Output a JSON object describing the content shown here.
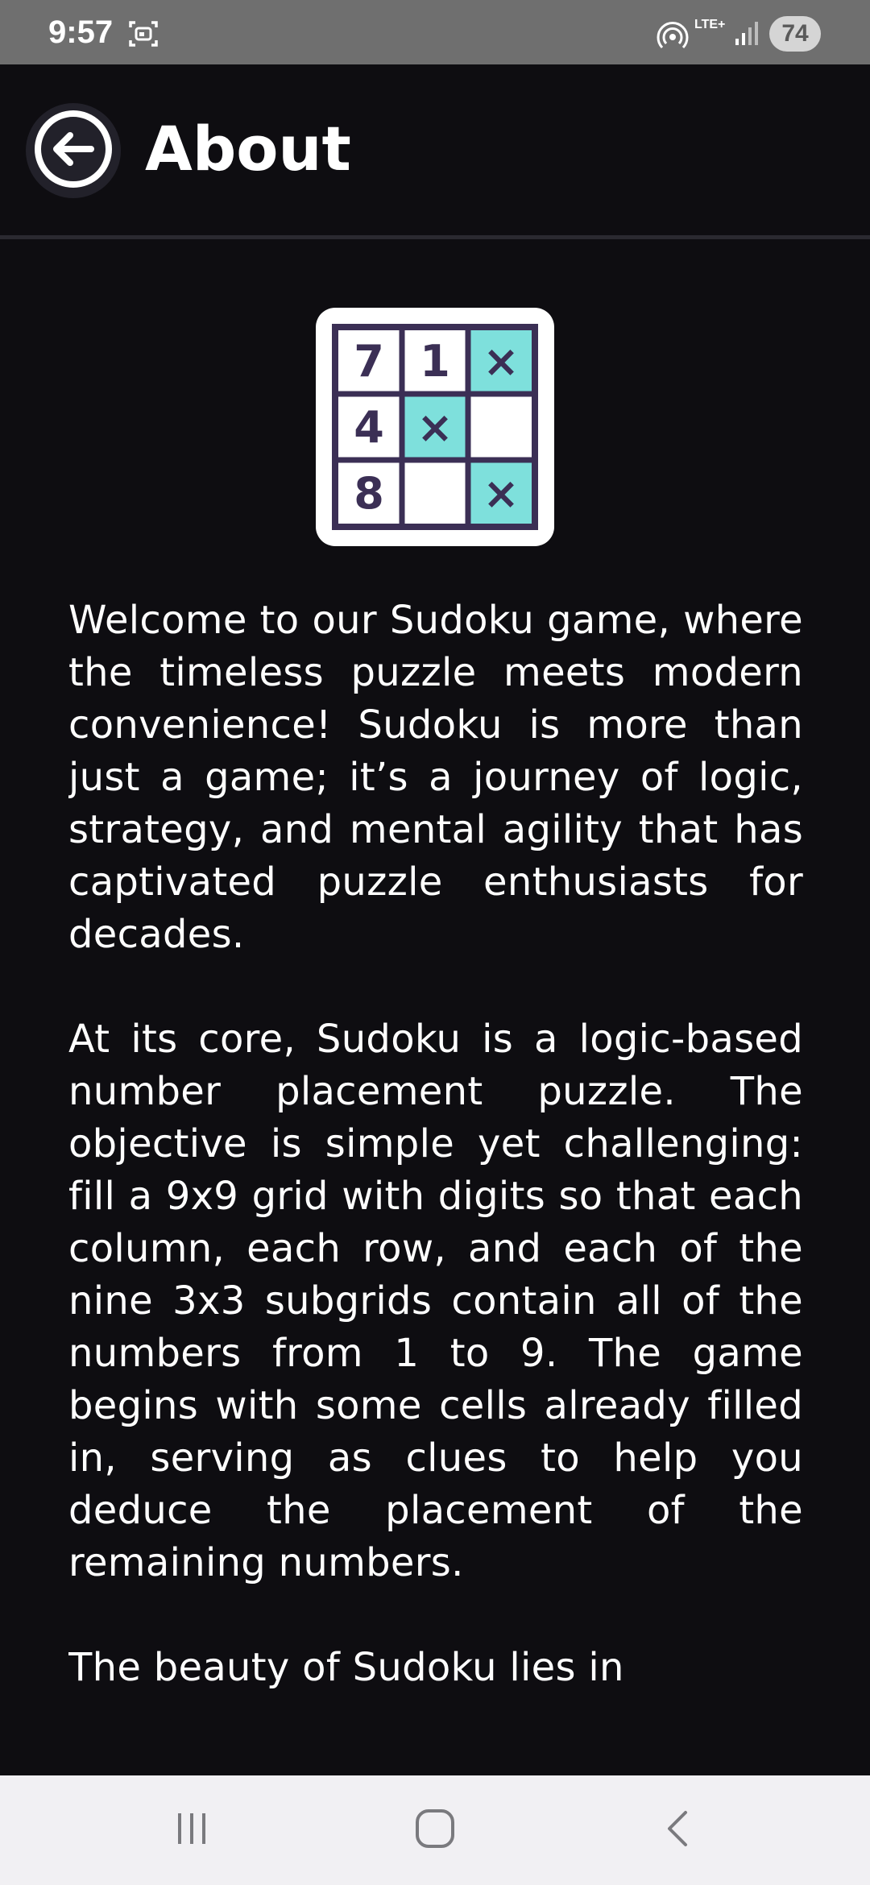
{
  "status_bar": {
    "time": "9:57",
    "network": "LTE+",
    "battery": "74"
  },
  "header": {
    "title": "About"
  },
  "logo": {
    "cells": [
      "7",
      "1",
      "×",
      "4",
      "×",
      "",
      "8",
      "",
      "×"
    ]
  },
  "content": {
    "paragraphs": [
      "Welcome to our Sudoku game, where the timeless puzzle meets modern convenience! Sudoku is more than just a game; it’s a journey of logic, strategy, and mental agility that has captivated puzzle enthusiasts for decades.",
      "At its core, Sudoku is a logic-based number placement puzzle. The objective is simple yet challenging: fill a 9x9 grid with digits so that each column, each row, and each of the nine 3x3 subgrids contain all of the numbers from 1 to 9. The game begins with some cells already filled in, serving as clues to help you deduce the placement of the remaining numbers.",
      "The beauty of Sudoku lies in"
    ]
  },
  "colors": {
    "background": "#0e0d11",
    "status_bar": "#6f6f6f",
    "logo_accent": "#7ee0dc",
    "logo_ink": "#3b2f55",
    "nav_bar": "#f1f0f3"
  },
  "icons": {
    "back": "arrow-left-circle-icon",
    "nav_recents": "recent-apps-icon",
    "nav_home": "home-icon",
    "nav_back": "chevron-left-icon"
  }
}
